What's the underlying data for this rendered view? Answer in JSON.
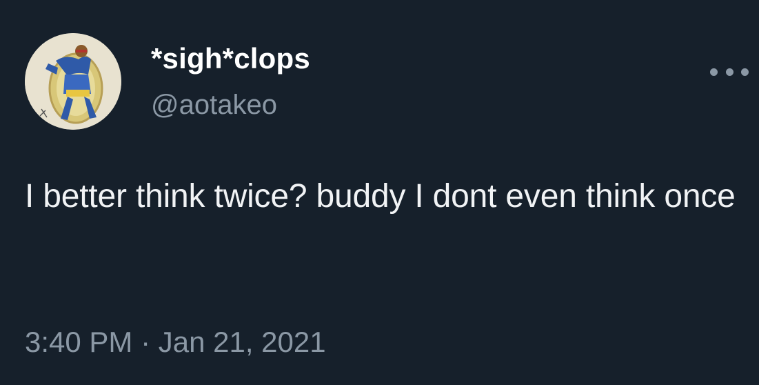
{
  "tweet": {
    "author": {
      "display_name": "*sigh*clops",
      "handle": "@aotakeo",
      "avatar_icon": "hand-drawn-cyclops-avatar"
    },
    "more_icon": "more-options-icon",
    "text": "I better think twice? buddy I dont even think once",
    "timestamp": "3:40 PM · Jan 21, 2021"
  },
  "colors": {
    "background": "#16202b",
    "primary_text": "#ffffff",
    "secondary_text": "#8b98a5"
  }
}
